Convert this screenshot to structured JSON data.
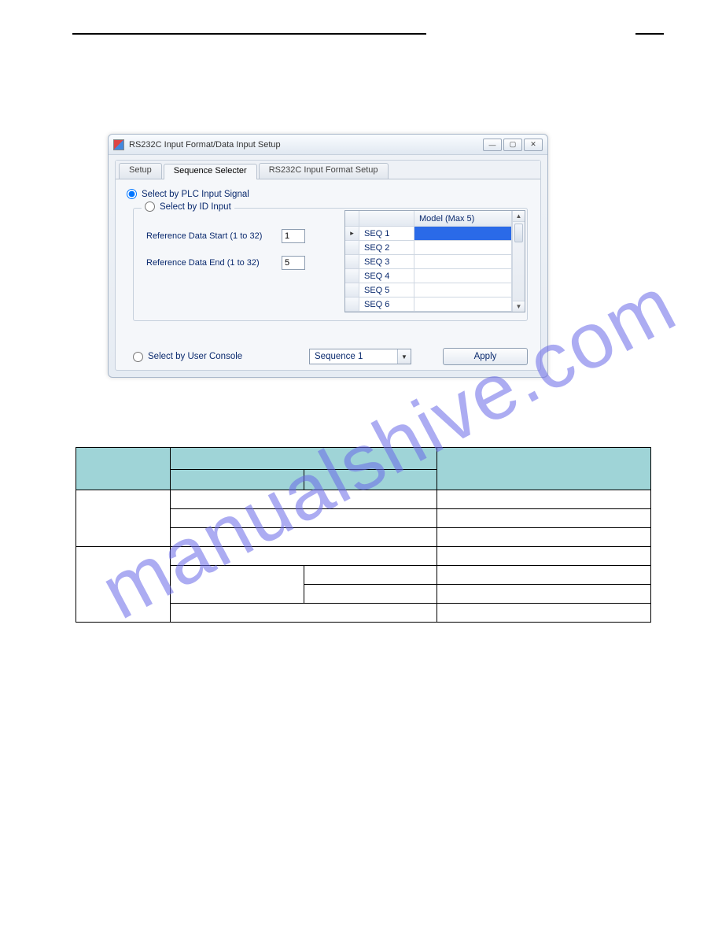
{
  "dialog": {
    "title": "RS232C Input Format/Data Input Setup",
    "tabs": {
      "setup": "Setup",
      "seq": "Sequence Selecter",
      "fmt": "RS232C Input Format Setup"
    },
    "radio_plc": "Select by PLC Input Signal",
    "radio_id": "Select by ID Input",
    "ref_start_label": "Reference Data Start (1 to 32)",
    "ref_start_val": "1",
    "ref_end_label": "Reference Data End (1 to 32)",
    "ref_end_val": "5",
    "grid_model_header": "Model (Max 5)",
    "seq_rows": [
      "SEQ 1",
      "SEQ 2",
      "SEQ 3",
      "SEQ 4",
      "SEQ 5",
      "SEQ 6"
    ],
    "radio_console": "Select by User Console",
    "combo_value": "Sequence 1",
    "apply": "Apply"
  },
  "watermark": "manualshive.com"
}
